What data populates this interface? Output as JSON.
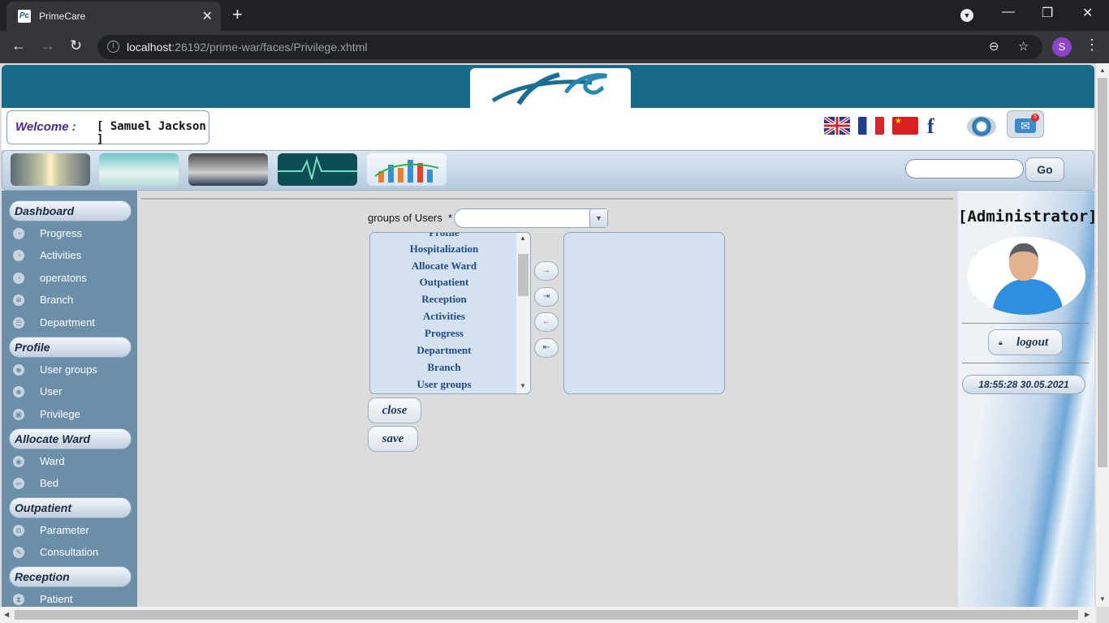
{
  "browser": {
    "tab_title": "PrimeCare",
    "url_host": "localhost",
    "url_path": ":26192/prime-war/faces/Privilege.xhtml",
    "profile_initial": "S"
  },
  "header": {
    "welcome_label": "Welcome :",
    "welcome_user": "[ Samuel Jackson ]",
    "mail_badge": "5"
  },
  "menubar": {
    "go_label": "Go",
    "search_value": ""
  },
  "sidebar": {
    "sections": [
      {
        "title": "Dashboard",
        "items": [
          "Progress",
          "Activities",
          "operatons",
          "Branch",
          "Department"
        ]
      },
      {
        "title": "Profile",
        "items": [
          "User groups",
          "User",
          "Privilege"
        ]
      },
      {
        "title": "Allocate Ward",
        "items": [
          "Ward",
          "Bed"
        ]
      },
      {
        "title": "Outpatient",
        "items": [
          "Parameter",
          "Consultation"
        ]
      },
      {
        "title": "Reception",
        "items": [
          "Patient"
        ]
      }
    ]
  },
  "form": {
    "group_label": "groups of Users",
    "required_mark": "*",
    "group_value": "",
    "source_items": [
      "Profile",
      "Hospitalization",
      "Allocate Ward",
      "Outpatient",
      "Reception",
      "Activities",
      "Progress",
      "Department",
      "Branch",
      "User groups"
    ],
    "target_items": [],
    "add_icon": "→",
    "add_all_icon": "⇥",
    "remove_icon": "←",
    "remove_all_icon": "⇤",
    "close_label": "close",
    "save_label": "save"
  },
  "user_panel": {
    "role": "[Administrator]",
    "logout_label": "logout",
    "clock": "18:55:28 30.05.2021"
  },
  "colors": {
    "banner": "#196a88",
    "sidebar": "#6c8fa9",
    "picklist": "#d4e2f0",
    "link_text": "#1f4a84"
  }
}
